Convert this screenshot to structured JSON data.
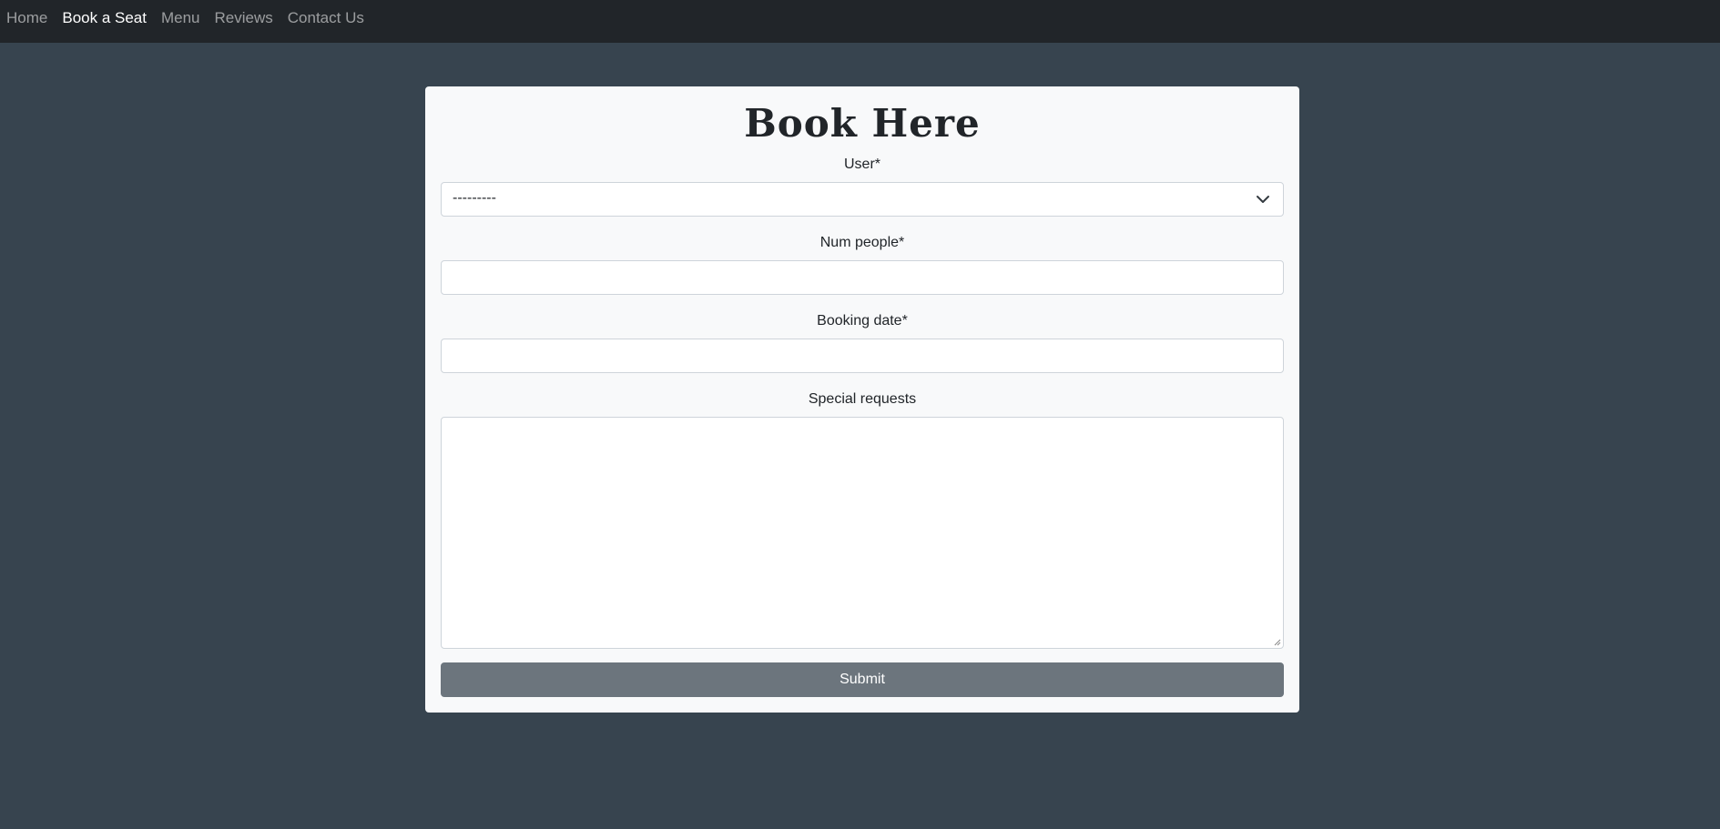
{
  "navbar": {
    "links": [
      {
        "label": "Home",
        "active": false
      },
      {
        "label": "Book a Seat",
        "active": true
      },
      {
        "label": "Menu",
        "active": false
      },
      {
        "label": "Reviews",
        "active": false
      },
      {
        "label": "Contact Us",
        "active": false
      }
    ]
  },
  "form": {
    "title": "Book Here",
    "user": {
      "label": "User*",
      "value": "---------"
    },
    "num_people": {
      "label": "Num people*",
      "value": ""
    },
    "booking_date": {
      "label": "Booking date*",
      "value": ""
    },
    "special_requests": {
      "label": "Special requests",
      "value": ""
    },
    "submit_label": "Submit"
  },
  "colors": {
    "page_bg": "#37444f",
    "navbar_bg": "#212529",
    "card_bg": "#f8f9fa",
    "button_bg": "#6c757d"
  }
}
